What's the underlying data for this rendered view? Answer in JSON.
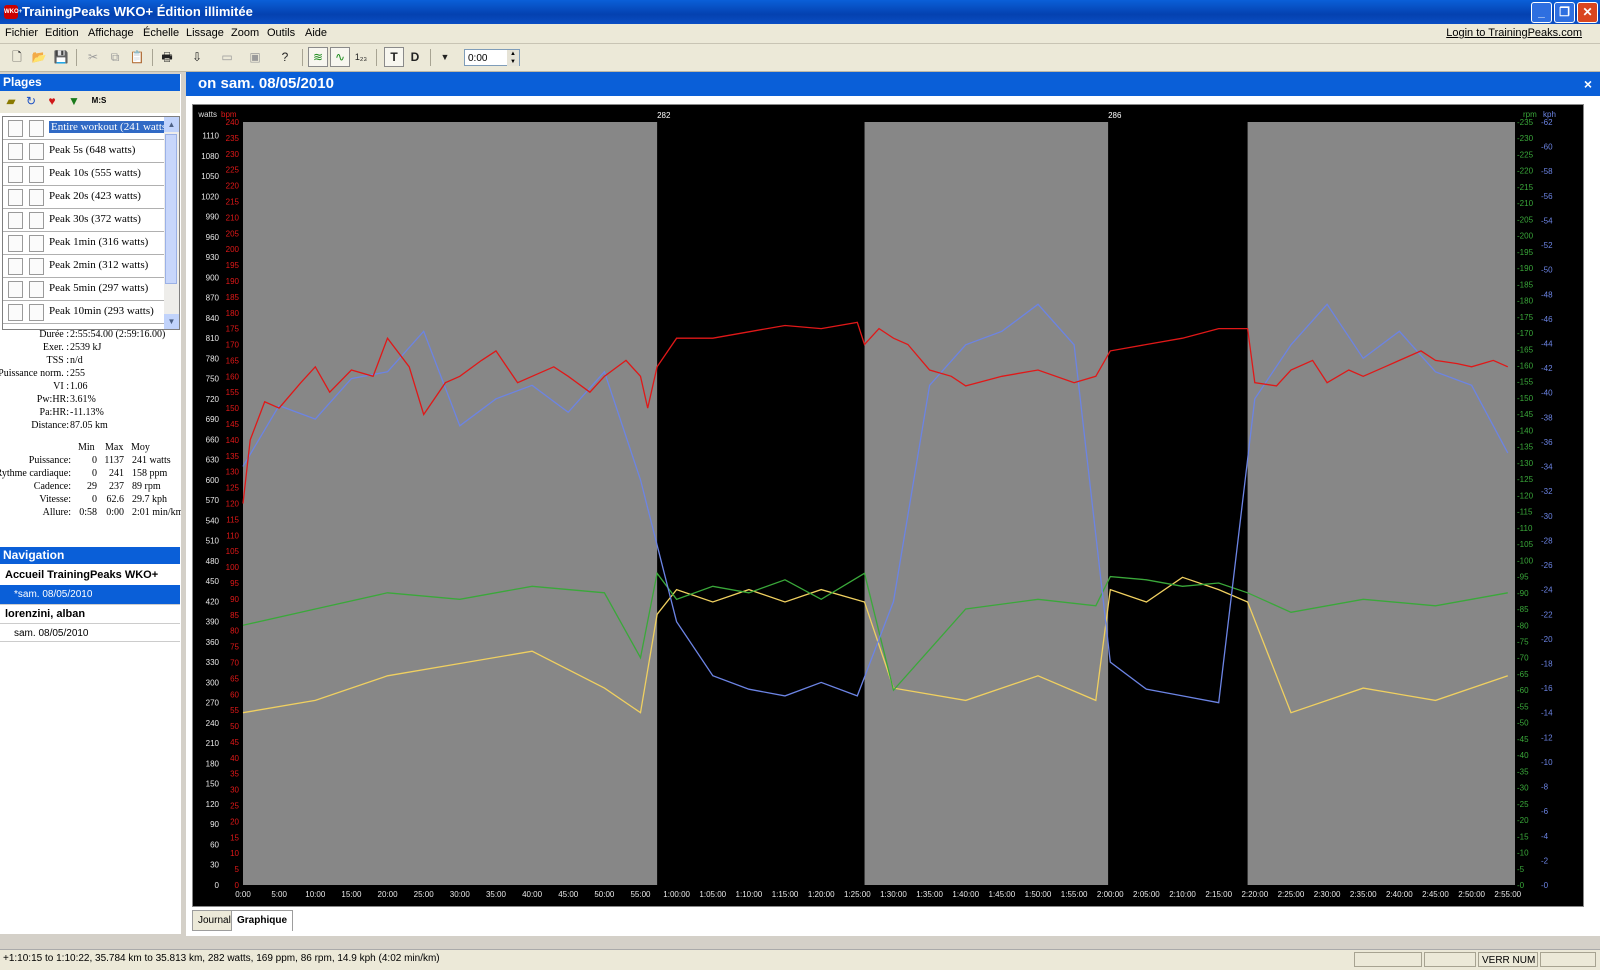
{
  "window": {
    "title": "TrainingPeaks WKO+ Édition illimitée",
    "icon_text": "WKO+",
    "minimize": "_",
    "restore": "❐",
    "close": "✕"
  },
  "menu": {
    "items": [
      "Fichier",
      "Edition",
      "Affichage",
      "Échelle",
      "Lissage",
      "Zoom",
      "Outils",
      "Aide"
    ],
    "login": "Login to TrainingPeaks.com"
  },
  "toolbar": {
    "time_value": "0:00",
    "t_label": "T",
    "d_label": "D",
    "count_label": "1₂₃"
  },
  "plages": {
    "title": "Plages",
    "ms_label": "M:S",
    "ranges": [
      "Entire workout (241 watts)",
      "Peak 5s (648 watts)",
      "Peak 10s (555 watts)",
      "Peak 20s (423 watts)",
      "Peak 30s (372 watts)",
      "Peak 1min (316 watts)",
      "Peak 2min (312 watts)",
      "Peak 5min (297 watts)",
      "Peak 10min (293 watts)"
    ]
  },
  "summary": [
    {
      "label": "Durée :",
      "value": "2:55:54.00 (2:59:16.00)"
    },
    {
      "label": "Exer. :",
      "value": "2539 kJ"
    },
    {
      "label": "TSS :",
      "value": "n/d"
    },
    {
      "label": "Puissance norm. :",
      "value": "255"
    },
    {
      "label": "VI :",
      "value": "1.06"
    },
    {
      "label": "Pw:HR:",
      "value": "3.61%"
    },
    {
      "label": "Pa:HR:",
      "value": "-11.13%"
    },
    {
      "label": "Distance:",
      "value": "87.05 km"
    }
  ],
  "metrics": {
    "headers": [
      "Min",
      "Max",
      "Moy"
    ],
    "rows": [
      {
        "label": "Puissance:",
        "min": "0",
        "max": "1137",
        "avg": "241 watts"
      },
      {
        "label": "Rythme cardiaque:",
        "min": "0",
        "max": "241",
        "avg": "158 ppm"
      },
      {
        "label": "Cadence:",
        "min": "29",
        "max": "237",
        "avg": "89 rpm"
      },
      {
        "label": "Vitesse:",
        "min": "0",
        "max": "62.6",
        "avg": "29.7 kph"
      },
      {
        "label": "Allure:",
        "min": "0:58",
        "max": "0:00",
        "avg": "2:01 min/km"
      }
    ]
  },
  "navigation": {
    "title": "Navigation",
    "items": [
      "Accueil TrainingPeaks WKO+",
      "*sam. 08/05/2010",
      "lorenzini, alban",
      "sam. 08/05/2010"
    ]
  },
  "workout": {
    "title": "on sam. 08/05/2010",
    "close": "×"
  },
  "tabs": [
    "Journal",
    "Graphique"
  ],
  "statusbar": {
    "text": "+1:10:15 to 1:10:22, 35.784 km to 35.813 km, 282 watts, 169 ppm, 86 rpm, 14.9 kph (4:02 min/km)",
    "num_lock": "VERR NUM"
  },
  "colors": {
    "power": "#6c84e4",
    "heart_rate": "#e01818",
    "cadence": "#3aa83a",
    "speed": "#f0d060",
    "chart_bg": "#878787",
    "interval_bg": "#000000",
    "accent": "#0a5fd8"
  },
  "chart_data": [
    {
      "type": "line",
      "title": "",
      "xlabel": "",
      "x_ticks": [
        "0:00",
        "5:00",
        "10:00",
        "15:00",
        "20:00",
        "25:00",
        "30:00",
        "35:00",
        "40:00",
        "45:00",
        "50:00",
        "55:00",
        "1:00:00",
        "1:05:00",
        "1:10:00",
        "1:15:00",
        "1:20:00",
        "1:25:00",
        "1:30:00",
        "1:35:00",
        "1:40:00",
        "1:45:00",
        "1:50:00",
        "1:55:00",
        "2:00:00",
        "2:05:00",
        "2:10:00",
        "2:15:00",
        "2:20:00",
        "2:25:00",
        "2:30:00",
        "2:35:00",
        "2:40:00",
        "2:45:00",
        "2:50:00",
        "2:55:00"
      ],
      "x_range_minutes": [
        0,
        176
      ],
      "interval_markers": [
        {
          "label": "282",
          "start_min": 57.3,
          "end_min": 86.0
        },
        {
          "label": "286",
          "start_min": 119.7,
          "end_min": 139.0
        }
      ],
      "axes": {
        "watts": {
          "label": "watts",
          "min": 0,
          "max": 1130,
          "step": 30
        },
        "bpm": {
          "label": "bpm",
          "min": 0,
          "max": 240,
          "step": 5
        },
        "rpm": {
          "label": "rpm",
          "min": 0,
          "max": 235,
          "step": 5
        },
        "kph": {
          "label": "kph",
          "min": 0,
          "max": 62,
          "step": 2
        }
      },
      "series": [
        {
          "name": "watts",
          "axis": "watts",
          "x": [
            0,
            5,
            10,
            15,
            20,
            25,
            30,
            35,
            40,
            45,
            50,
            55,
            60,
            65,
            70,
            75,
            80,
            85,
            90,
            95,
            100,
            105,
            110,
            115,
            120,
            125,
            130,
            135,
            140,
            145,
            150,
            155,
            160,
            165,
            170,
            175
          ],
          "values": [
            620,
            710,
            690,
            750,
            760,
            820,
            680,
            720,
            740,
            700,
            760,
            600,
            390,
            310,
            290,
            280,
            300,
            280,
            420,
            740,
            800,
            820,
            860,
            800,
            330,
            290,
            280,
            270,
            720,
            800,
            860,
            780,
            820,
            760,
            740,
            640
          ]
        },
        {
          "name": "bpm",
          "axis": "bpm",
          "x": [
            0,
            1,
            3,
            5,
            8,
            10,
            12,
            15,
            18,
            20,
            23,
            25,
            28,
            30,
            33,
            35,
            38,
            40,
            43,
            45,
            48,
            50,
            53,
            55,
            56,
            57.3,
            60,
            65,
            70,
            75,
            80,
            85,
            86,
            88,
            90,
            92,
            95,
            98,
            100,
            105,
            110,
            115,
            118,
            120,
            125,
            130,
            135,
            139,
            140,
            143,
            145,
            148,
            150,
            153,
            155,
            158,
            160,
            163,
            165,
            168,
            170,
            173,
            175
          ],
          "values": [
            120,
            140,
            152,
            150,
            158,
            163,
            155,
            162,
            160,
            172,
            163,
            148,
            158,
            160,
            165,
            168,
            158,
            160,
            163,
            160,
            155,
            160,
            165,
            160,
            150,
            163,
            172,
            172,
            174,
            176,
            175,
            177,
            170,
            175,
            172,
            170,
            162,
            160,
            157,
            160,
            162,
            158,
            160,
            168,
            170,
            172,
            175,
            175,
            158,
            157,
            162,
            165,
            158,
            162,
            160,
            163,
            165,
            168,
            165,
            164,
            163,
            165,
            163
          ]
        },
        {
          "name": "rpm",
          "axis": "rpm",
          "x": [
            0,
            10,
            20,
            30,
            40,
            50,
            55,
            57.3,
            60,
            65,
            70,
            75,
            80,
            86,
            90,
            100,
            110,
            118,
            120,
            125,
            130,
            135,
            139,
            145,
            155,
            165,
            175
          ],
          "values": [
            80,
            85,
            90,
            88,
            92,
            90,
            70,
            96,
            88,
            92,
            90,
            94,
            88,
            96,
            60,
            85,
            88,
            86,
            95,
            94,
            92,
            93,
            90,
            84,
            88,
            86,
            90
          ]
        },
        {
          "name": "kph",
          "axis": "kph",
          "x": [
            0,
            10,
            20,
            30,
            40,
            50,
            55,
            57.3,
            60,
            65,
            70,
            75,
            80,
            86,
            90,
            100,
            110,
            118,
            120,
            125,
            130,
            135,
            139,
            145,
            155,
            165,
            175
          ],
          "values": [
            14,
            15,
            17,
            18,
            19,
            16,
            14,
            22,
            24,
            23,
            24,
            23,
            24,
            23,
            16,
            15,
            17,
            15,
            24,
            23,
            25,
            24,
            23,
            14,
            16,
            15,
            17
          ]
        }
      ]
    }
  ]
}
